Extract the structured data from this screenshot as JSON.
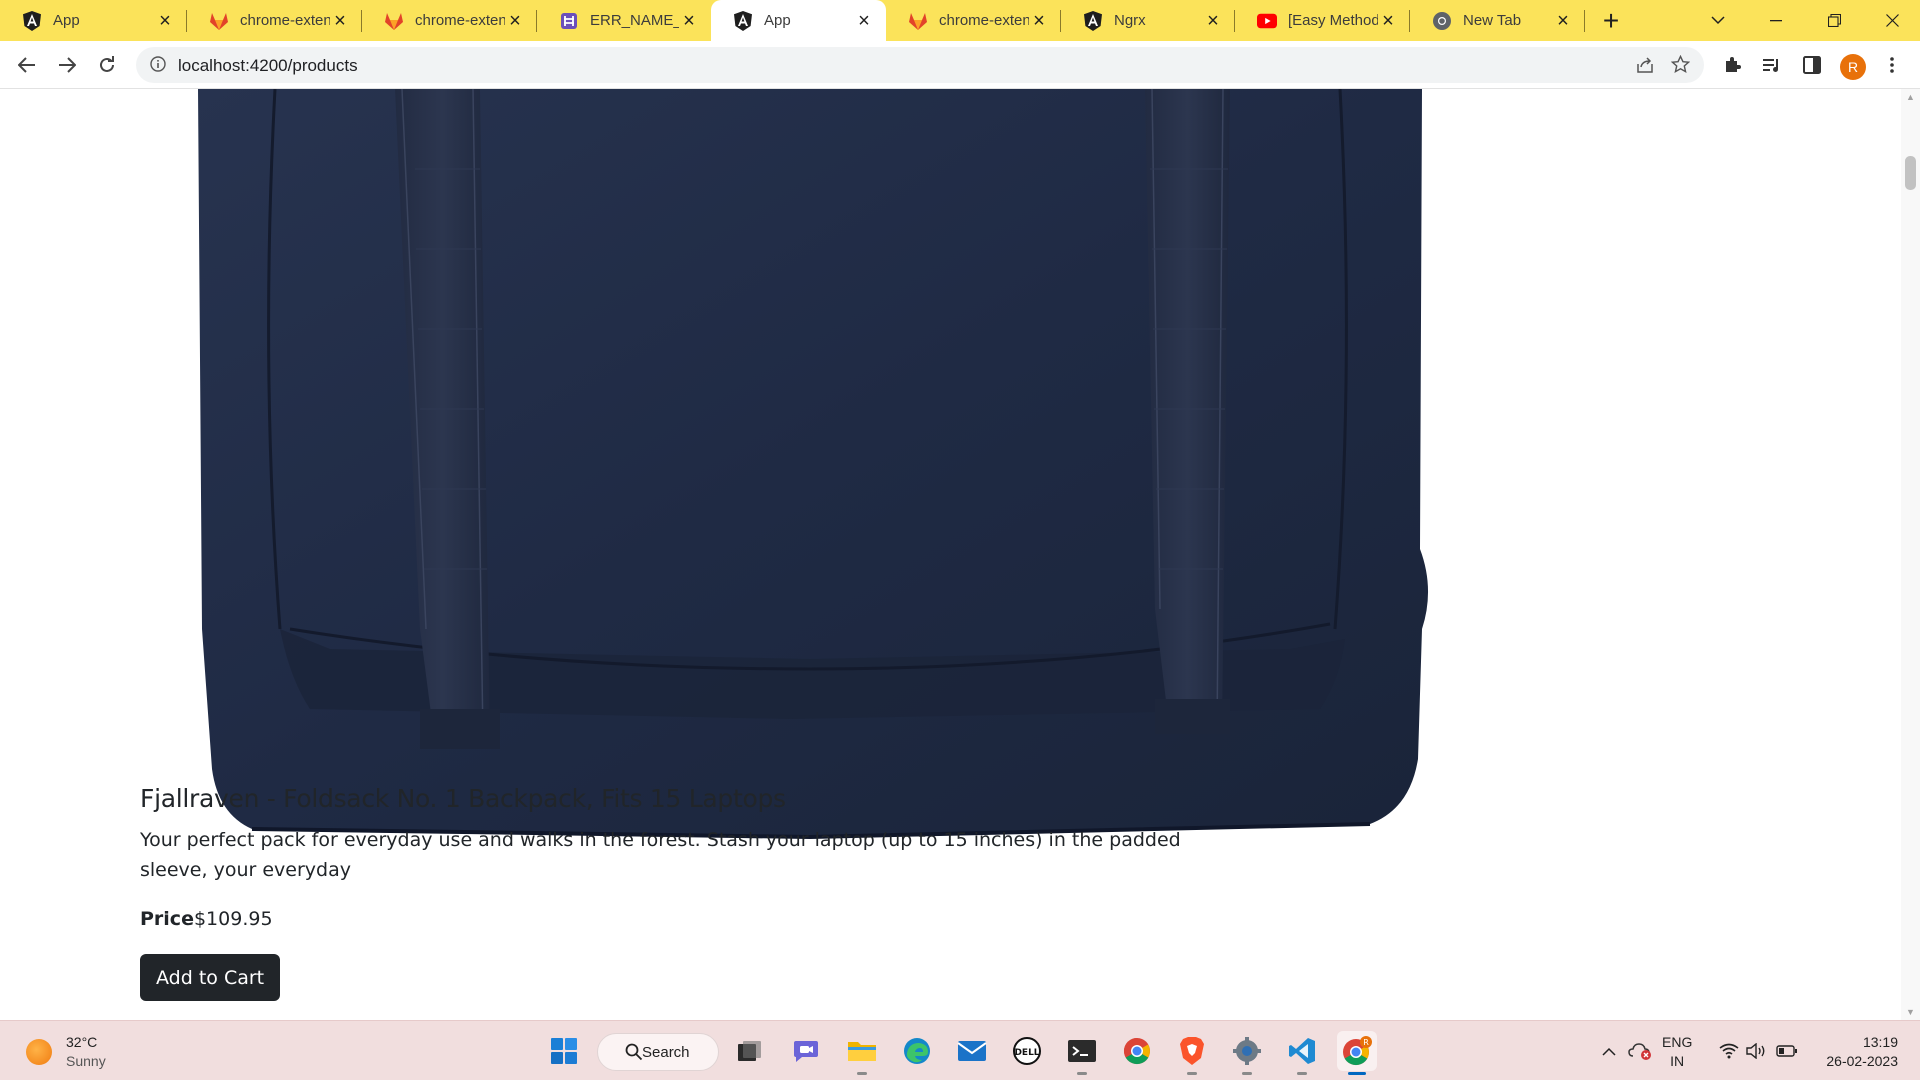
{
  "browser": {
    "tabs": [
      {
        "title": "App",
        "icon": "angular-icon",
        "active": false
      },
      {
        "title": "chrome-extens",
        "icon": "gitlab-icon",
        "active": false
      },
      {
        "title": "chrome-extens",
        "icon": "gitlab-icon",
        "active": false
      },
      {
        "title": "ERR_NAME_NO",
        "icon": "hashnode-icon",
        "active": false
      },
      {
        "title": "App",
        "icon": "angular-icon",
        "active": true
      },
      {
        "title": "chrome-extens",
        "icon": "gitlab-icon",
        "active": false
      },
      {
        "title": "Ngrx",
        "icon": "angular-icon",
        "active": false
      },
      {
        "title": "[Easy Method]",
        "icon": "youtube-icon",
        "active": false
      },
      {
        "title": "New Tab",
        "icon": "chrome-icon",
        "active": false
      }
    ],
    "url": "localhost:4200/products",
    "profile_initial": "R",
    "accent_color": "#fbe35a"
  },
  "product": {
    "title": "Fjallraven - Foldsack No. 1 Backpack, Fits 15 Laptops",
    "description": "Your perfect pack for everyday use and walks in the forest. Stash your laptop (up to 15 inches) in the padded sleeve, your everyday",
    "price_label": "Price",
    "price_value": "$109.95",
    "add_to_cart_label": "Add to Cart",
    "image_color": "#1f2a44"
  },
  "taskbar": {
    "weather_temp": "32°C",
    "weather_condition": "Sunny",
    "search_label": "Search",
    "lang_primary": "ENG",
    "lang_secondary": "IN",
    "time": "13:19",
    "date": "26-02-2023"
  }
}
